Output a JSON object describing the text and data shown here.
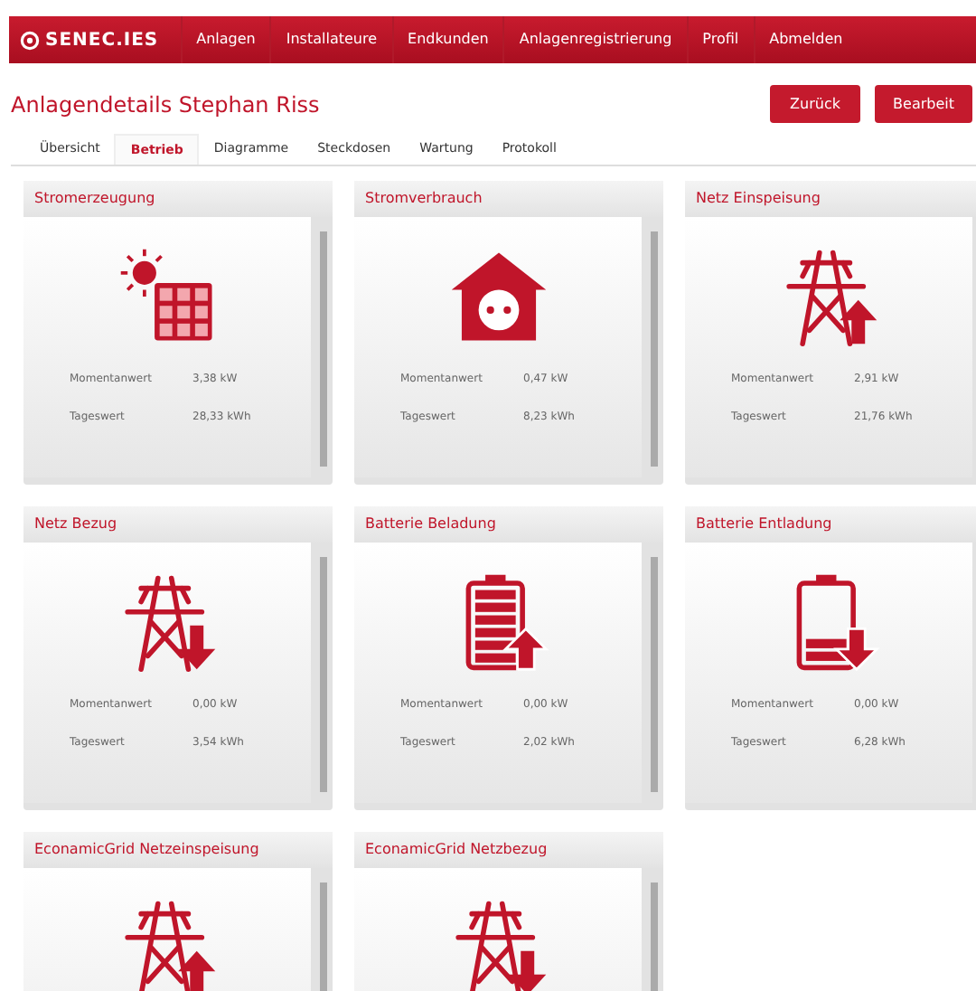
{
  "nav": {
    "logo": "SENEC.IES",
    "items": [
      "Anlagen",
      "Installateure",
      "Endkunden",
      "Anlagenregistrierung",
      "Profil",
      "Abmelden"
    ]
  },
  "page": {
    "title": "Anlagendetails Stephan Riss",
    "buttons": [
      "Zurück",
      "Bearbeit"
    ]
  },
  "tabs": [
    {
      "label": "Übersicht",
      "selected": false
    },
    {
      "label": "Betrieb",
      "selected": true
    },
    {
      "label": "Diagramme",
      "selected": false
    },
    {
      "label": "Steckdosen",
      "selected": false
    },
    {
      "label": "Wartung",
      "selected": false
    },
    {
      "label": "Protokoll",
      "selected": false
    }
  ],
  "cards": [
    {
      "title": "Stromerzeugung",
      "kind": "solar",
      "rows": [
        {
          "label": "Momentanwert",
          "value": "3,38 kW"
        },
        {
          "label": "Tageswert",
          "value": "28,33 kWh"
        }
      ]
    },
    {
      "title": "Stromverbrauch",
      "kind": "house",
      "rows": [
        {
          "label": "Momentanwert",
          "value": "0,47 kW"
        },
        {
          "label": "Tageswert",
          "value": "8,23 kWh"
        }
      ]
    },
    {
      "title": "Netz Einspeisung",
      "kind": "grid-up",
      "rows": [
        {
          "label": "Momentanwert",
          "value": "2,91 kW"
        },
        {
          "label": "Tageswert",
          "value": "21,76 kWh"
        }
      ]
    },
    {
      "title": "Netz Bezug",
      "kind": "grid-down",
      "rows": [
        {
          "label": "Momentanwert",
          "value": "0,00 kW"
        },
        {
          "label": "Tageswert",
          "value": "3,54 kWh"
        }
      ]
    },
    {
      "title": "Batterie Beladung",
      "kind": "battery-up",
      "rows": [
        {
          "label": "Momentanwert",
          "value": "0,00 kW"
        },
        {
          "label": "Tageswert",
          "value": "2,02 kWh"
        }
      ]
    },
    {
      "title": "Batterie Entladung",
      "kind": "battery-down",
      "rows": [
        {
          "label": "Momentanwert",
          "value": "0,00 kW"
        },
        {
          "label": "Tageswert",
          "value": "6,28 kWh"
        }
      ]
    },
    {
      "title": "EconamicGrid Netzeinspeisung",
      "kind": "grid-up"
    },
    {
      "title": "EconamicGrid Netzbezug",
      "kind": "grid-down"
    }
  ]
}
